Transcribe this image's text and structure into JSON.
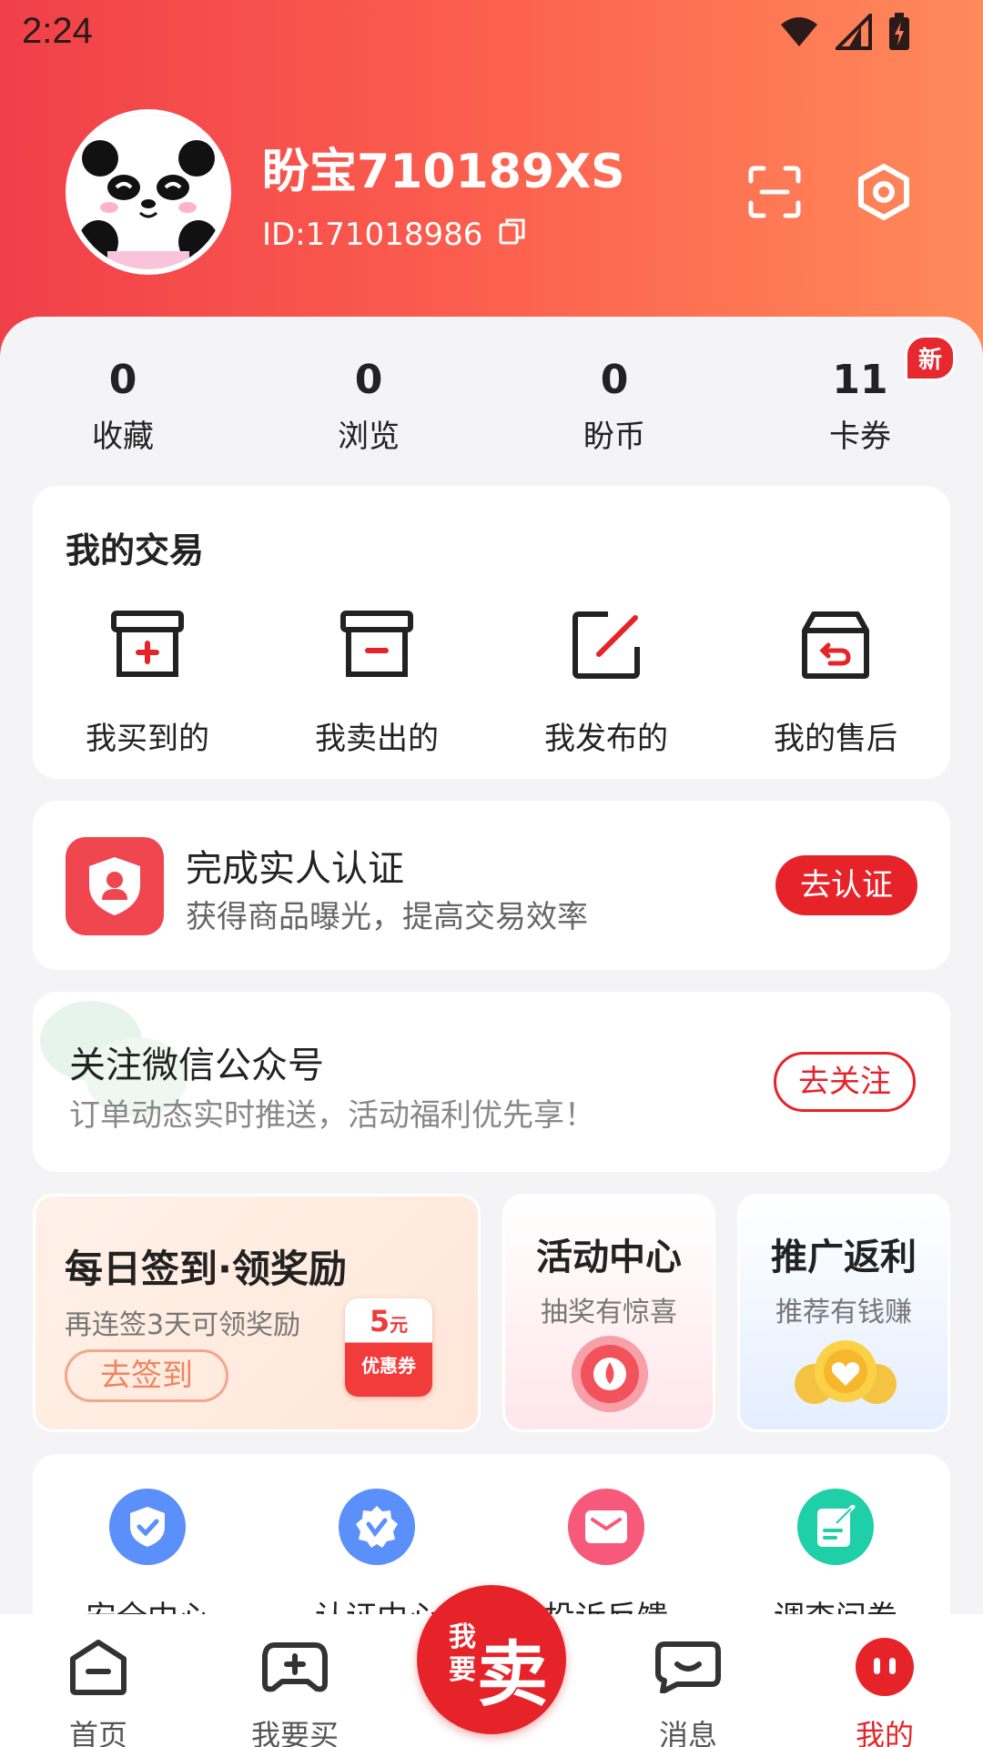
{
  "status_bar": {
    "time": "2:24"
  },
  "profile": {
    "username": "盼宝710189XS",
    "user_id": "ID:171018986"
  },
  "stats": [
    {
      "value": "0",
      "label": "收藏"
    },
    {
      "value": "0",
      "label": "浏览"
    },
    {
      "value": "0",
      "label": "盼币"
    },
    {
      "value": "11",
      "label": "卡券",
      "badge": "新"
    }
  ],
  "my_trade": {
    "title": "我的交易",
    "items": [
      {
        "label": "我买到的",
        "icon": "box-plus-icon"
      },
      {
        "label": "我卖出的",
        "icon": "box-minus-icon"
      },
      {
        "label": "我发布的",
        "icon": "edit-square-icon"
      },
      {
        "label": "我的售后",
        "icon": "box-return-icon"
      }
    ]
  },
  "verify": {
    "title": "完成实人认证",
    "subtitle": "获得商品曝光，提高交易效率",
    "button": "去认证"
  },
  "wechat": {
    "title": "关注微信公众号",
    "subtitle": "订单动态实时推送，活动福利优先享！",
    "button": "去关注"
  },
  "promos": {
    "signin": {
      "title": "每日签到·领奖励",
      "subtitle": "再连签3天可领奖励",
      "button": "去签到",
      "coupon_amount": "5",
      "coupon_unit": "元",
      "coupon_label": "优惠券"
    },
    "activity": {
      "title": "活动中心",
      "subtitle": "抽奖有惊喜"
    },
    "promote": {
      "title": "推广返利",
      "subtitle": "推荐有钱赚"
    }
  },
  "services": [
    {
      "label": "安全中心",
      "icon": "shield-check-icon",
      "color": "#5b8ff9"
    },
    {
      "label": "认证中心",
      "icon": "badge-check-icon",
      "color": "#5b8ff9"
    },
    {
      "label": "投诉反馈",
      "icon": "mail-icon",
      "color": "#f7597a"
    },
    {
      "label": "调查问卷",
      "icon": "survey-icon",
      "color": "#1fcfa8"
    }
  ],
  "tabbar": {
    "tabs": [
      {
        "label": "首页",
        "icon": "home-icon"
      },
      {
        "label": "我要买",
        "icon": "gamepad-icon"
      },
      {
        "label": "消息",
        "icon": "message-icon"
      },
      {
        "label": "我的",
        "icon": "profile-icon"
      }
    ],
    "sell_small": "我要",
    "sell_big": "卖"
  },
  "colors": {
    "accent": "#e7232a",
    "header_start": "#f0404a",
    "header_end": "#ff8a5a"
  }
}
